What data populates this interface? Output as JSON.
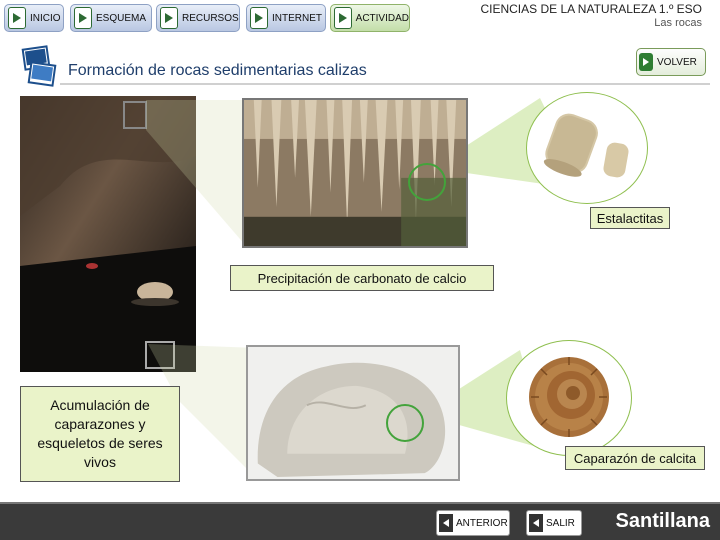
{
  "nav": [
    {
      "label": "INICIO",
      "style": "blue"
    },
    {
      "label": "ESQUEMA",
      "style": "blue"
    },
    {
      "label": "RECURSOS",
      "style": "blue"
    },
    {
      "label": "INTERNET",
      "style": "blue"
    },
    {
      "label": "ACTIVIDAD",
      "style": "green"
    }
  ],
  "header": {
    "subject": "CIENCIAS DE LA NATURALEZA 1.º ESO",
    "unit": "Las rocas"
  },
  "page_title": "Formación de rocas sedimentarias calizas",
  "volver_label": "VOLVER",
  "labels": {
    "estalactitas": "Estalactitas",
    "precipitacion": "Precipitación de carbonato de calcio",
    "acumulacion": "Acumulación de caparazones y esqueletos de seres vivos",
    "caparazon": "Caparazón de calcita"
  },
  "footer": {
    "anterior_label": "ANTERIOR",
    "salir_label": "SALIR",
    "brand": "Santillana"
  },
  "colors": {
    "accent_green": "#43a33b",
    "label_bg": "#eaf3c9",
    "footer_bg": "#3a3a3a"
  }
}
